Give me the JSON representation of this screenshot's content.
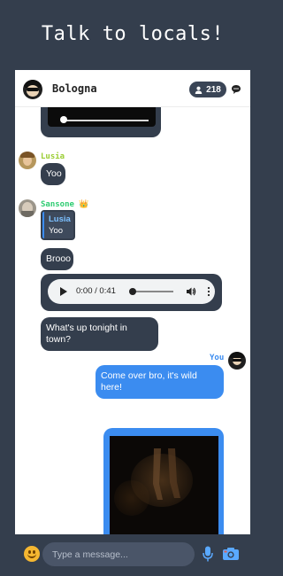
{
  "headline": "Talk to locals!",
  "header": {
    "room_name": "Bologna",
    "member_count": "218"
  },
  "messages": {
    "lusia_name": "Lusia",
    "lusia_text": "Yoo",
    "sansone_name": "Sansone",
    "sansone_badge": "👑",
    "reply_quote_name": "Lusia",
    "reply_quote_text": "Yoo",
    "sansone_text_1": "Brooo",
    "audio_time": "0:00 / 0:41",
    "sansone_text_2": "What's up tonight in town?",
    "self_name": "You",
    "self_text": "Come over bro, it's wild here!"
  },
  "composer": {
    "placeholder": "Type a message..."
  },
  "colors": {
    "dark_bubble": "#343e4d",
    "my_bubble": "#3b8cf0",
    "lusia_name": "#9acd32",
    "sansone_name": "#2ecc71",
    "you_name": "#3b8cf0"
  },
  "icons": [
    "user-icon",
    "chat-bubble-icon",
    "emoji-icon",
    "mic-icon",
    "camera-icon",
    "play-icon",
    "volume-icon",
    "more-icon",
    "fullscreen-icon"
  ]
}
